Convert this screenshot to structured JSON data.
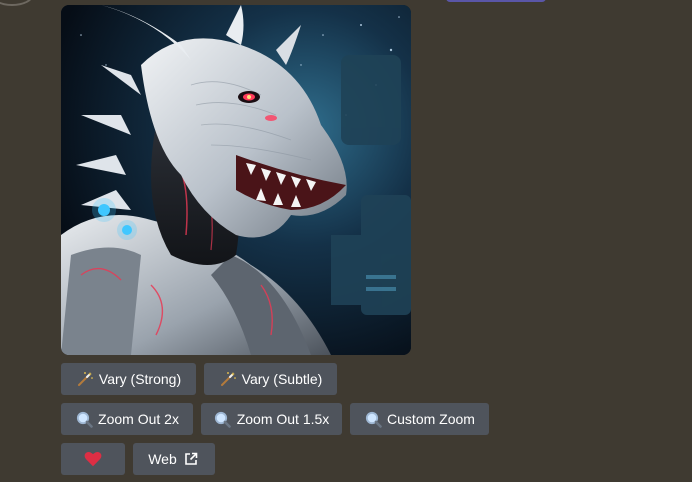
{
  "image": {
    "subject_icon": "dragon-robot-artwork",
    "accent_colors": {
      "glow_red": "#e83a55",
      "glow_blue": "#3fc7ff",
      "armor": "#cfd3d8"
    }
  },
  "buttons_row1": [
    {
      "label": "Vary (Strong)",
      "icon": "magic-wand-icon"
    },
    {
      "label": "Vary (Subtle)",
      "icon": "magic-wand-icon"
    }
  ],
  "buttons_row2": [
    {
      "label": "Zoom Out 2x",
      "icon": "magnifier-icon"
    },
    {
      "label": "Zoom Out 1.5x",
      "icon": "magnifier-icon"
    },
    {
      "label": "Custom Zoom",
      "icon": "magnifier-icon"
    }
  ],
  "buttons_row3": [
    {
      "label": "",
      "icon": "heart-icon"
    },
    {
      "label": "Web",
      "icon": "external-link-icon"
    }
  ],
  "colors": {
    "background": "#3f3a31",
    "button": "#4f545c",
    "heart": "#dd2e44"
  }
}
